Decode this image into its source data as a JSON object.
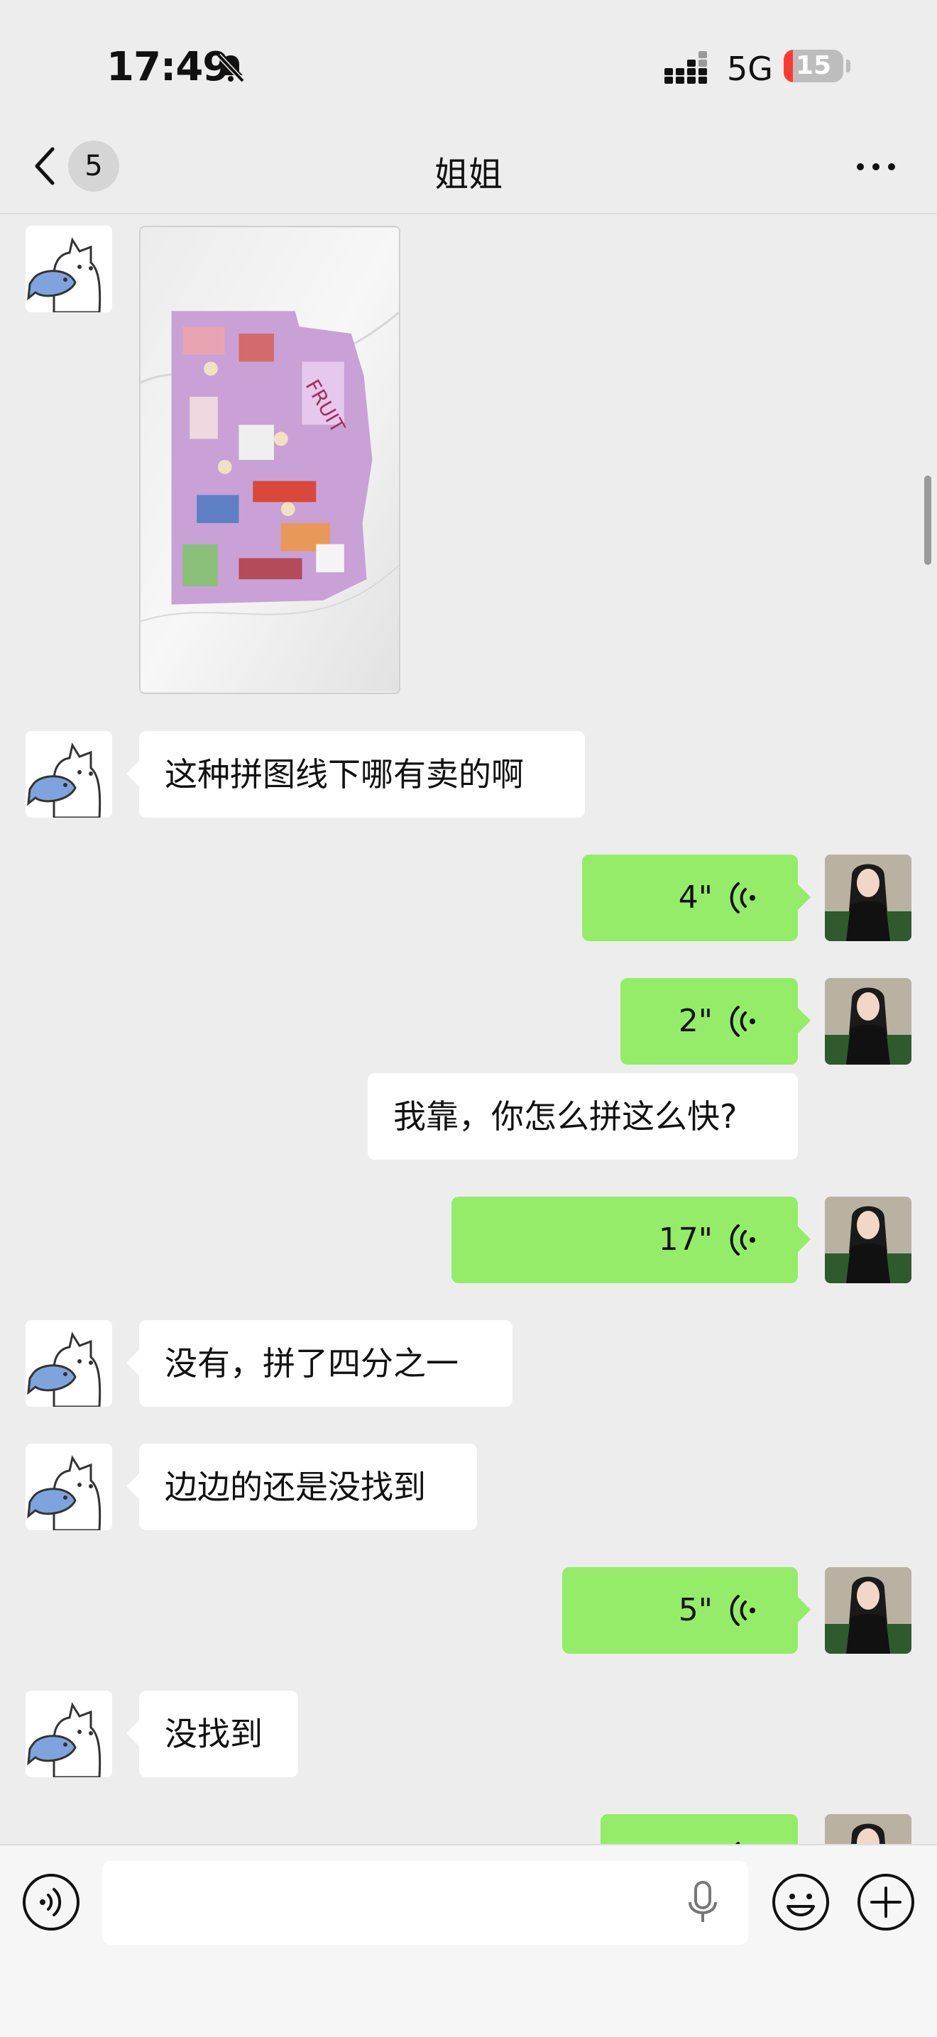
{
  "status_bar": {
    "time": "17:49",
    "network": "5G",
    "battery": "15",
    "battery_level": 0.15
  },
  "header": {
    "title": "姐姐",
    "unread_count": "5"
  },
  "messages": [
    {
      "id": "m1",
      "side": "left",
      "type": "image",
      "description": "puzzle photo"
    },
    {
      "id": "m2",
      "side": "left",
      "type": "text",
      "text": "这种拼图线下哪有卖的啊"
    },
    {
      "id": "m3",
      "side": "right",
      "type": "voice",
      "duration": "4\""
    },
    {
      "id": "m4",
      "side": "right",
      "type": "voice",
      "duration": "2\""
    },
    {
      "id": "m5",
      "side": "right",
      "type": "text",
      "text": "我靠，你怎么拼这么快?"
    },
    {
      "id": "m6",
      "side": "right",
      "type": "voice",
      "duration": "17\""
    },
    {
      "id": "m7",
      "side": "left",
      "type": "text",
      "text": "没有，拼了四分之一"
    },
    {
      "id": "m8",
      "side": "left",
      "type": "text",
      "text": "边边的还是没找到"
    },
    {
      "id": "m9",
      "side": "right",
      "type": "voice",
      "duration": "5\""
    },
    {
      "id": "m10",
      "side": "left",
      "type": "text",
      "text": "没找到"
    },
    {
      "id": "m11",
      "side": "right",
      "type": "voice",
      "duration": ""
    }
  ],
  "icons": {
    "back": "chevron-left-icon",
    "more": "more-dots-icon",
    "mute": "bell-slash-icon",
    "signal": "cellular-signal-icon",
    "voice": "voice-wave-icon",
    "mic": "microphone-icon",
    "emoji": "emoji-icon",
    "plus": "plus-icon",
    "voice_mode": "voice-mode-icon"
  },
  "colors": {
    "outgoing_bubble": "#95ec69",
    "incoming_bubble": "#ffffff",
    "background": "#ededed",
    "battery_low": "#ff3b30"
  }
}
